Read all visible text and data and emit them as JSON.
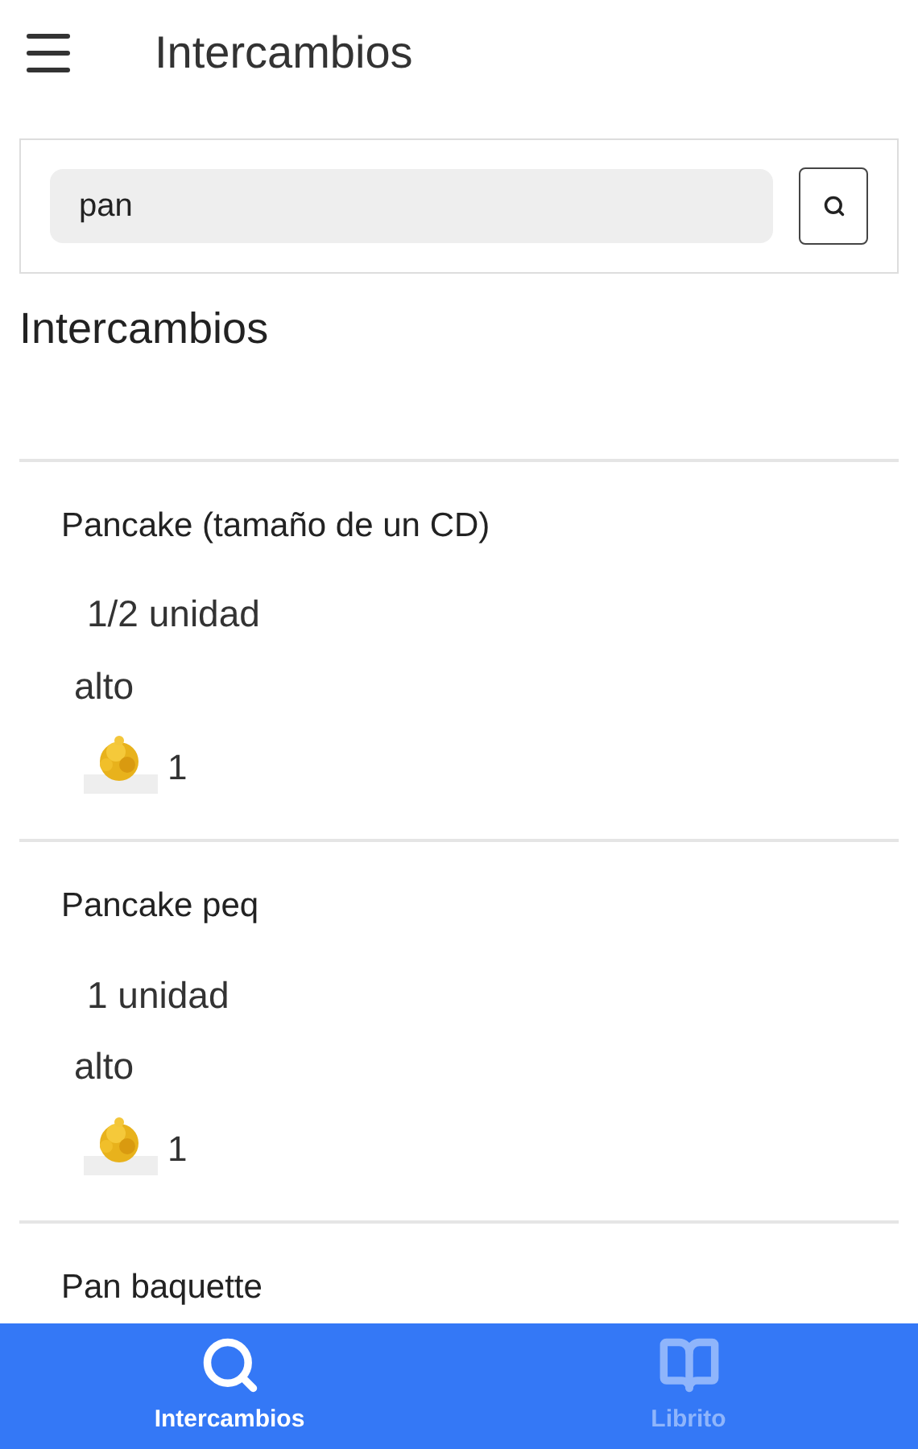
{
  "app_bar": {
    "title": "Intercambios"
  },
  "search": {
    "value": "pan"
  },
  "section_title": "Intercambios",
  "items": [
    {
      "name": "Pancake (tamaño de un CD)",
      "portion": "1/2 unidad",
      "level_text": "alto",
      "count": "1"
    },
    {
      "name": "Pancake peq",
      "portion": "1 unidad",
      "level_text": "alto",
      "count": "1"
    },
    {
      "name": "Pan baquette"
    }
  ],
  "nav": [
    {
      "label": "Intercambios",
      "kind": "search",
      "selected": true
    },
    {
      "label": "Librito",
      "kind": "book",
      "selected": false
    }
  ]
}
